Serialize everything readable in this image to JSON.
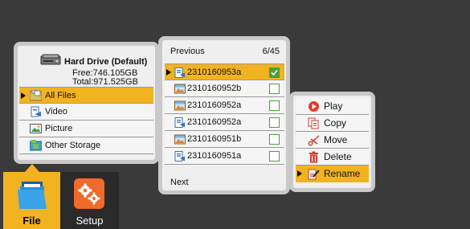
{
  "storage": {
    "drive_name": "Hard Drive (Default)",
    "free": "Free:746.105GB",
    "total": "Total:971.525GB",
    "items": [
      {
        "label": "All Files",
        "icon": "folder-files-icon",
        "selected": true
      },
      {
        "label": "Video",
        "icon": "video-icon",
        "selected": false
      },
      {
        "label": "Picture",
        "icon": "picture-icon",
        "selected": false
      },
      {
        "label": "Other Storage",
        "icon": "other-storage-icon",
        "selected": false
      }
    ]
  },
  "files": {
    "previous": "Previous",
    "page": "6/45",
    "next": "Next",
    "items": [
      {
        "name": "2310160953a",
        "icon": "video-file-icon",
        "checked": true,
        "selected": true
      },
      {
        "name": "2310160952b",
        "icon": "image-file-icon",
        "checked": false,
        "selected": false
      },
      {
        "name": "2310160952a",
        "icon": "image-file-icon",
        "checked": false,
        "selected": false
      },
      {
        "name": "2310160952a",
        "icon": "video-file-icon",
        "checked": false,
        "selected": false
      },
      {
        "name": "2310160951b",
        "icon": "image-file-icon",
        "checked": false,
        "selected": false
      },
      {
        "name": "2310160951a",
        "icon": "video-file-icon",
        "checked": false,
        "selected": false
      }
    ]
  },
  "menu": {
    "items": [
      {
        "label": "Play",
        "icon": "play-icon"
      },
      {
        "label": "Copy",
        "icon": "copy-icon"
      },
      {
        "label": "Move",
        "icon": "scissors-icon"
      },
      {
        "label": "Delete",
        "icon": "trash-icon"
      },
      {
        "label": "Rename",
        "icon": "rename-icon"
      }
    ]
  },
  "tabs": {
    "file": "File",
    "setup": "Setup"
  },
  "colors": {
    "accent": "#f2b321",
    "background": "#3a3a3a",
    "panel": "#efefef",
    "panel_border": "#c9c9c9",
    "check": "#4aa03a",
    "setup_icon": "#f06a2a"
  }
}
